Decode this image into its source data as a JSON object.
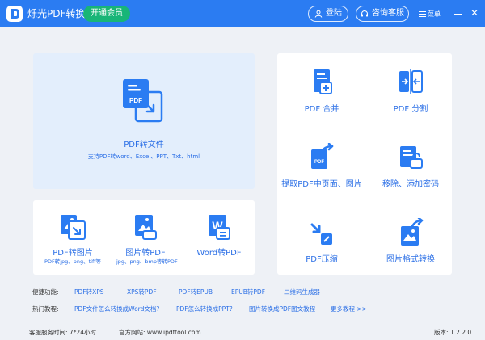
{
  "titlebar": {
    "app_title": "烁光PDF转换器",
    "vip_button": "开通会员",
    "login_button": "登陆",
    "service_button": "咨询客服",
    "menu_label": "菜单"
  },
  "main_tool": {
    "label": "PDF转文件",
    "sub": "支持PDF转word、Excel、PPT、Txt、html",
    "icon_text": "PDF"
  },
  "bottom_tools": [
    {
      "label": "PDF转图片",
      "sub": "PDF转jpg、png、tiff等"
    },
    {
      "label": "图片转PDF",
      "sub": "jpg、png、bmp等转PDF"
    },
    {
      "label": "Word转PDF",
      "sub": ""
    }
  ],
  "right_tools": [
    {
      "label": "PDF 合并"
    },
    {
      "label": "PDF 分割"
    },
    {
      "label": "提取PDF中页面、图片"
    },
    {
      "label": "移除、添加密码"
    },
    {
      "label": "PDF压缩"
    },
    {
      "label": "图片格式转换"
    }
  ],
  "quick_links": {
    "label": "便捷功能:",
    "items": [
      "PDF转XPS",
      "XPS转PDF",
      "PDF转EPUB",
      "EPUB转PDF",
      "二维码生成器"
    ]
  },
  "tutorials": {
    "label": "热门教程:",
    "items": [
      "PDF文件怎么转换成Word文档?",
      "PDF怎么转换成PPT?",
      "图片转换成PDF图文教程",
      "更多教程 >>"
    ]
  },
  "status": {
    "service_time": "客服服务时间:  7*24小时",
    "website": "官方网站:  www.ipdftool.com",
    "version": "版本:  1.2.2.0"
  },
  "colors": {
    "primary": "#2b7cf2",
    "vip": "#18b577",
    "text_blue": "#2b6fe6"
  }
}
